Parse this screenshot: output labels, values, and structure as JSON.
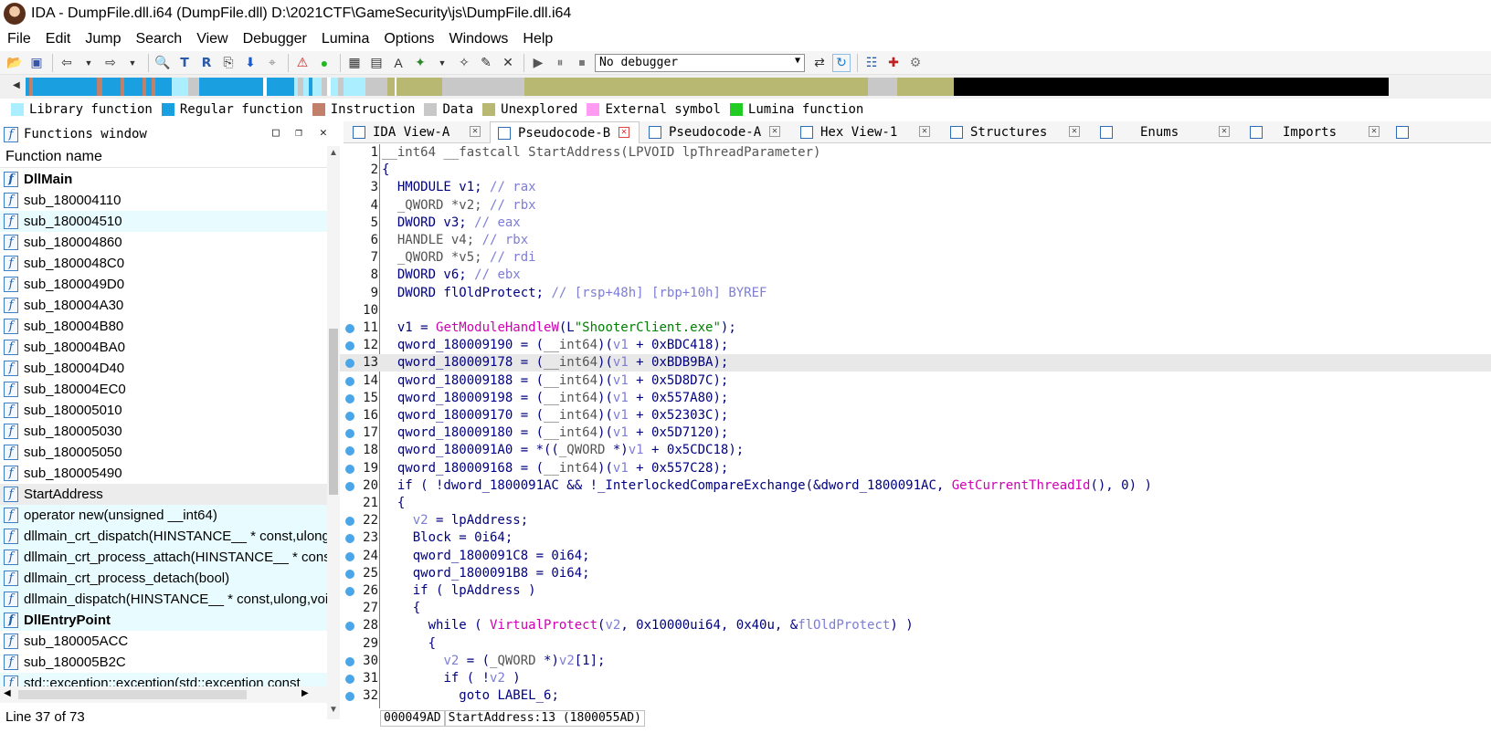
{
  "window": {
    "title": "IDA - DumpFile.dll.i64 (DumpFile.dll) D:\\2021CTF\\GameSecurity\\js\\DumpFile.dll.i64"
  },
  "menu": [
    "File",
    "Edit",
    "Jump",
    "Search",
    "View",
    "Debugger",
    "Lumina",
    "Options",
    "Windows",
    "Help"
  ],
  "toolbar": {
    "debugger_select": "No debugger"
  },
  "legend": [
    {
      "label": "Library function",
      "color": "#aaeeff"
    },
    {
      "label": "Regular function",
      "color": "#1aa0e0"
    },
    {
      "label": "Instruction",
      "color": "#c0806a"
    },
    {
      "label": "Data",
      "color": "#c8c8c8"
    },
    {
      "label": "Unexplored",
      "color": "#b8b872"
    },
    {
      "label": "External symbol",
      "color": "#ff9bf0"
    },
    {
      "label": "Lumina function",
      "color": "#22cc22"
    }
  ],
  "functions_window": {
    "title": "Functions window",
    "column_header": "Function name",
    "items": [
      {
        "name": "DllMain",
        "bold": true,
        "lib": false
      },
      {
        "name": "sub_180004110",
        "bold": false,
        "lib": false
      },
      {
        "name": "sub_180004510",
        "bold": false,
        "lib": true
      },
      {
        "name": "sub_180004860",
        "bold": false,
        "lib": false
      },
      {
        "name": "sub_1800048C0",
        "bold": false,
        "lib": false
      },
      {
        "name": "sub_1800049D0",
        "bold": false,
        "lib": false
      },
      {
        "name": "sub_180004A30",
        "bold": false,
        "lib": false
      },
      {
        "name": "sub_180004B80",
        "bold": false,
        "lib": false
      },
      {
        "name": "sub_180004BA0",
        "bold": false,
        "lib": false
      },
      {
        "name": "sub_180004D40",
        "bold": false,
        "lib": false
      },
      {
        "name": "sub_180004EC0",
        "bold": false,
        "lib": false
      },
      {
        "name": "sub_180005010",
        "bold": false,
        "lib": false
      },
      {
        "name": "sub_180005030",
        "bold": false,
        "lib": false
      },
      {
        "name": "sub_180005050",
        "bold": false,
        "lib": false
      },
      {
        "name": "sub_180005490",
        "bold": false,
        "lib": false
      },
      {
        "name": "StartAddress",
        "bold": false,
        "lib": false,
        "selected": true
      },
      {
        "name": "operator new(unsigned __int64)",
        "bold": false,
        "lib": true
      },
      {
        "name": "dllmain_crt_dispatch(HINSTANCE__ * const,ulong",
        "bold": false,
        "lib": true
      },
      {
        "name": "dllmain_crt_process_attach(HINSTANCE__ * const",
        "bold": false,
        "lib": true
      },
      {
        "name": "dllmain_crt_process_detach(bool)",
        "bold": false,
        "lib": true
      },
      {
        "name": "dllmain_dispatch(HINSTANCE__ * const,ulong,void",
        "bold": false,
        "lib": true
      },
      {
        "name": "DllEntryPoint",
        "bold": true,
        "lib": true
      },
      {
        "name": "sub_180005ACC",
        "bold": false,
        "lib": false
      },
      {
        "name": "sub_180005B2C",
        "bold": false,
        "lib": false
      },
      {
        "name": "std::exception::exception(std::exception const",
        "bold": false,
        "lib": true
      }
    ],
    "status": "Line 37 of 73"
  },
  "tabs": [
    {
      "label": "IDA View-A",
      "active": false
    },
    {
      "label": "Pseudocode-B",
      "active": true
    },
    {
      "label": "Pseudocode-A",
      "active": false
    },
    {
      "label": "Hex View-1",
      "active": false
    },
    {
      "label": "Structures",
      "active": false
    },
    {
      "label": "Enums",
      "active": false
    },
    {
      "label": "Imports",
      "active": false
    }
  ],
  "code_lines": [
    {
      "n": "1",
      "bp": false,
      "html": "<span class='g'>__int64 __fastcall StartAddress(LPVOID lpThreadParameter)</span>"
    },
    {
      "n": "2",
      "bp": false,
      "html": "<span class='k'>{</span>"
    },
    {
      "n": "3",
      "bp": false,
      "html": "  <span class='k'>HMODULE v1;</span> <span class='c'>// rax</span>"
    },
    {
      "n": "4",
      "bp": false,
      "html": "  <span class='g'>_QWORD *v2;</span> <span class='c'>// rbx</span>"
    },
    {
      "n": "5",
      "bp": false,
      "html": "  <span class='k'>DWORD v3;</span> <span class='c'>// eax</span>"
    },
    {
      "n": "6",
      "bp": false,
      "html": "  <span class='g'>HANDLE v4;</span> <span class='c'>// rbx</span>"
    },
    {
      "n": "7",
      "bp": false,
      "html": "  <span class='g'>_QWORD *v5;</span> <span class='c'>// rdi</span>"
    },
    {
      "n": "8",
      "bp": false,
      "html": "  <span class='k'>DWORD v6;</span> <span class='c'>// ebx</span>"
    },
    {
      "n": "9",
      "bp": false,
      "html": "  <span class='k'>DWORD flOldProtect;</span> <span class='c'>// [rsp+48h] [rbp+10h] BYREF</span>"
    },
    {
      "n": "10",
      "bp": false,
      "html": ""
    },
    {
      "n": "11",
      "bp": true,
      "html": "  <span class='k'>v1 = </span><span class='m'>GetModuleHandleW</span><span class='k'>(L</span><span class='s'>\"ShooterClient.exe\"</span><span class='k'>);</span>"
    },
    {
      "n": "12",
      "bp": true,
      "html": "  <span class='k'>qword_180009190 = (</span><span class='g'>__int64</span><span class='k'>)(</span><span class='c'>v1</span><span class='k'> + 0xBDC418);</span>"
    },
    {
      "n": "13",
      "bp": true,
      "hl": true,
      "html": "  <span class='k'>qword_180009178 = (</span><span class='g'>__int64</span><span class='k'>)(</span><span class='c'>v1</span><span class='k'> + 0xBDB9BA);</span>"
    },
    {
      "n": "14",
      "bp": true,
      "html": "  <span class='k'>qword_180009188 = (</span><span class='g'>__int64</span><span class='k'>)(</span><span class='c'>v1</span><span class='k'> + 0x5D8D7C);</span>"
    },
    {
      "n": "15",
      "bp": true,
      "html": "  <span class='k'>qword_180009198 = (</span><span class='g'>__int64</span><span class='k'>)(</span><span class='c'>v1</span><span class='k'> + 0x557A80);</span>"
    },
    {
      "n": "16",
      "bp": true,
      "html": "  <span class='k'>qword_180009170 = (</span><span class='g'>__int64</span><span class='k'>)(</span><span class='c'>v1</span><span class='k'> + 0x52303C);</span>"
    },
    {
      "n": "17",
      "bp": true,
      "html": "  <span class='k'>qword_180009180 = (</span><span class='g'>__int64</span><span class='k'>)(</span><span class='c'>v1</span><span class='k'> + 0x5D7120);</span>"
    },
    {
      "n": "18",
      "bp": true,
      "html": "  <span class='k'>qword_1800091A0 = *((</span><span class='g'>_QWORD</span><span class='k'> *)</span><span class='c'>v1</span><span class='k'> + 0x5CDC18);</span>"
    },
    {
      "n": "19",
      "bp": true,
      "html": "  <span class='k'>qword_180009168 = (</span><span class='g'>__int64</span><span class='k'>)(</span><span class='c'>v1</span><span class='k'> + 0x557C28);</span>"
    },
    {
      "n": "20",
      "bp": true,
      "html": "  <span class='k'>if ( !dword_1800091AC &amp;&amp; !_InterlockedCompareExchange(&amp;dword_1800091AC, </span><span class='m'>GetCurrentThreadId</span><span class='k'>(), 0) )</span>"
    },
    {
      "n": "21",
      "bp": false,
      "html": "  <span class='k'>{</span>"
    },
    {
      "n": "22",
      "bp": true,
      "html": "    <span class='c'>v2</span><span class='k'> = lpAddress;</span>"
    },
    {
      "n": "23",
      "bp": true,
      "html": "    <span class='k'>Block = 0i64;</span>"
    },
    {
      "n": "24",
      "bp": true,
      "html": "    <span class='k'>qword_1800091C8 = 0i64;</span>"
    },
    {
      "n": "25",
      "bp": true,
      "html": "    <span class='k'>qword_1800091B8 = 0i64;</span>"
    },
    {
      "n": "26",
      "bp": true,
      "html": "    <span class='k'>if ( lpAddress )</span>"
    },
    {
      "n": "27",
      "bp": false,
      "html": "    <span class='k'>{</span>"
    },
    {
      "n": "28",
      "bp": true,
      "html": "      <span class='k'>while ( </span><span class='m'>VirtualProtect</span><span class='k'>(</span><span class='c'>v2</span><span class='k'>, 0x10000ui64, 0x40u, &amp;</span><span class='c'>flOldProtect</span><span class='k'>) )</span>"
    },
    {
      "n": "29",
      "bp": false,
      "html": "      <span class='k'>{</span>"
    },
    {
      "n": "30",
      "bp": true,
      "html": "        <span class='c'>v2</span><span class='k'> = (</span><span class='g'>_QWORD</span><span class='k'> *)</span><span class='c'>v2</span><span class='k'>[1];</span>"
    },
    {
      "n": "31",
      "bp": true,
      "html": "        <span class='k'>if ( !</span><span class='c'>v2</span><span class='k'> )</span>"
    },
    {
      "n": "32",
      "bp": true,
      "html": "          <span class='k'>goto LABEL_6;</span>"
    }
  ],
  "status_bar": {
    "offset": "000049AD",
    "location": "StartAddress:13 (1800055AD)"
  }
}
